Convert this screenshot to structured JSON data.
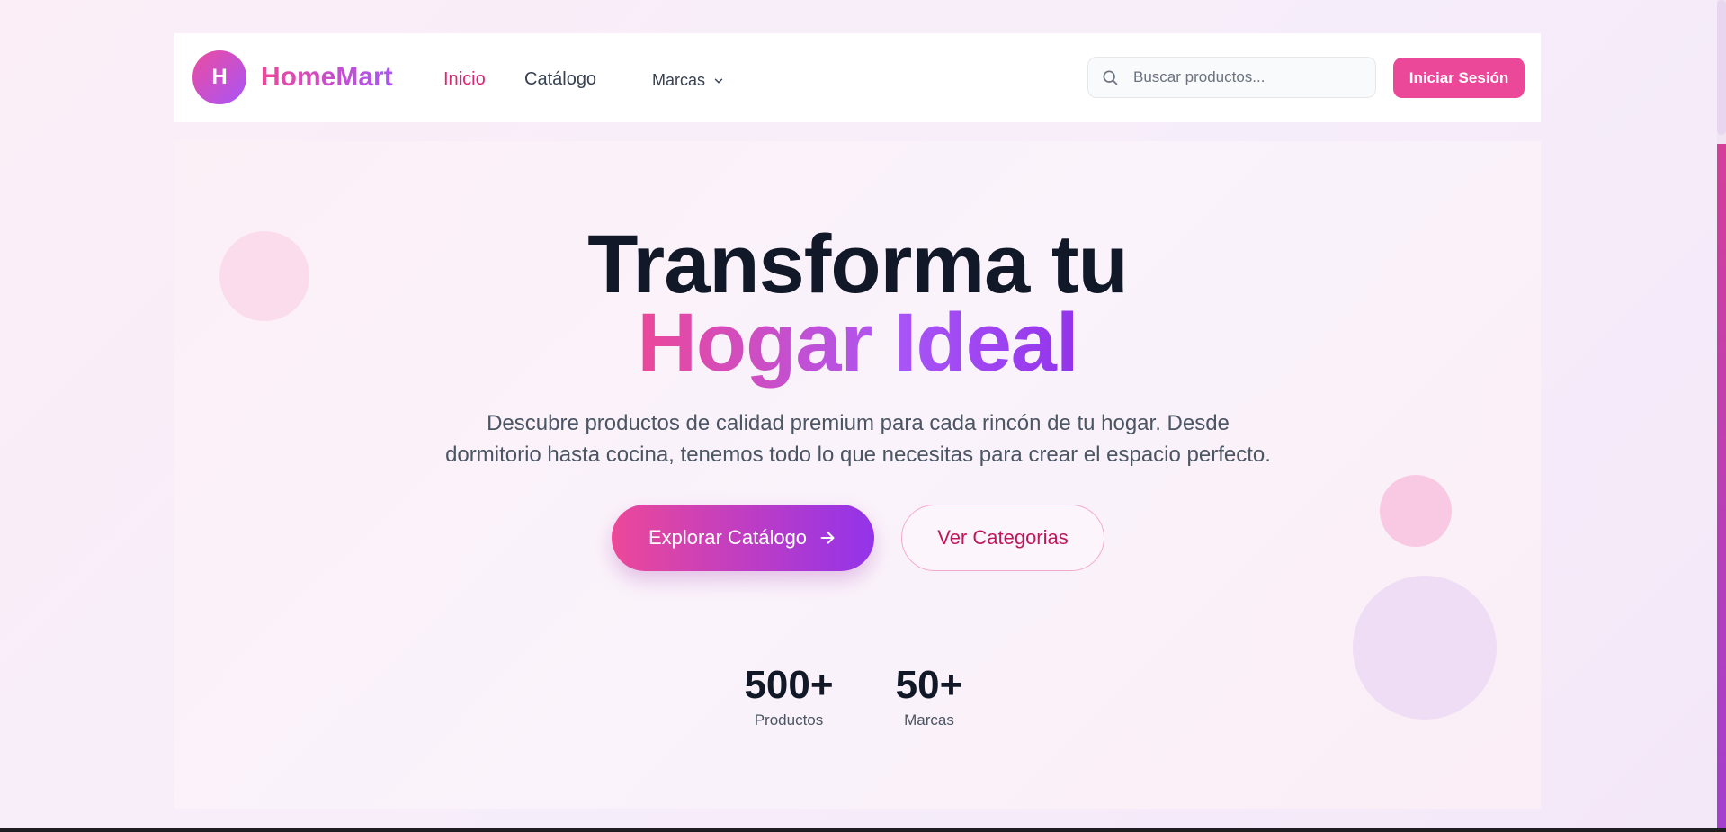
{
  "navbar": {
    "logo_letter": "H",
    "brand": "HomeMart",
    "links": [
      {
        "label": "Inicio",
        "active": true
      },
      {
        "label": "Catálogo",
        "active": false
      }
    ],
    "dropdown_label": "Marcas",
    "search_placeholder": "Buscar productos...",
    "login_label": "Iniciar Sesión"
  },
  "hero": {
    "title_line1": "Transforma tu",
    "title_line2": "Hogar Ideal",
    "subtitle_line1": "Descubre productos de calidad premium para cada rincón de tu hogar. Desde",
    "subtitle_line2": "dormitorio hasta cocina, tenemos todo lo que necesitas para crear el espacio perfecto.",
    "primary_cta": "Explorar Catálogo",
    "secondary_cta": "Ver Categorias",
    "stats": [
      {
        "value": "500+",
        "label": "Productos"
      },
      {
        "value": "50+",
        "label": "Marcas"
      }
    ]
  },
  "colors": {
    "accent_pink": "#ec4899",
    "accent_purple": "#9333ea",
    "title_dark": "#111827"
  },
  "icons": [
    "search-icon",
    "chevron-down-icon",
    "arrow-right-icon"
  ]
}
